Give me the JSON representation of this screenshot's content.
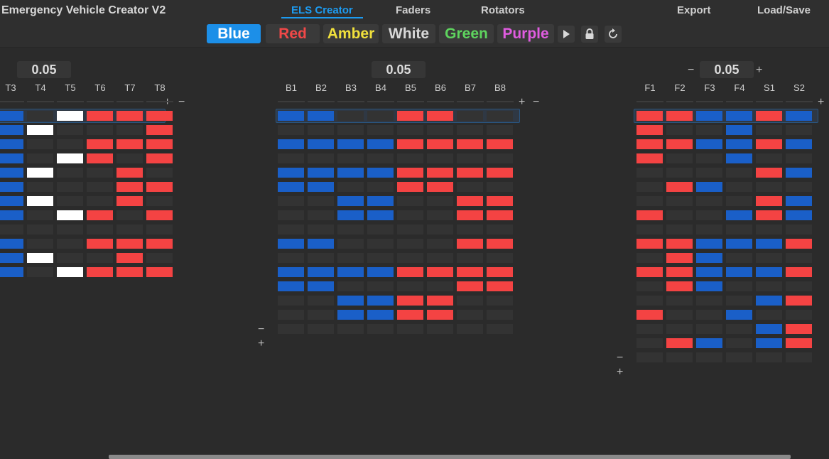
{
  "app": {
    "title": "Emergency Vehicle Creator V2"
  },
  "nav": {
    "tabs": [
      {
        "label": "ELS Creator",
        "active": true
      },
      {
        "label": "Faders"
      },
      {
        "label": "Rotators"
      }
    ],
    "right": [
      {
        "label": "Export"
      },
      {
        "label": "Load/Save"
      }
    ]
  },
  "colors": {
    "buttons": [
      {
        "label": "Blue",
        "color": "#ffffff",
        "bg": "#1c8fe8",
        "selected": true
      },
      {
        "label": "Red",
        "color": "#f14848"
      },
      {
        "label": "Amber",
        "color": "#f0e03c"
      },
      {
        "label": "White",
        "color": "#d8d8d8"
      },
      {
        "label": "Green",
        "color": "#5ed45e"
      },
      {
        "label": "Purple",
        "color": "#e05ce0"
      }
    ],
    "icons": [
      "play-icon",
      "lock-icon",
      "refresh-icon"
    ],
    "cell_palette": {
      "B": "#1a5fc8",
      "R": "#f44343",
      "W": "#ffffff",
      "E": "#333333"
    }
  },
  "panels": [
    {
      "name": "panel-t",
      "duration": "0.05",
      "headers": [
        "T3",
        "T4",
        "T5",
        "T6",
        "T7",
        "T8"
      ],
      "rows": [
        "B.WRRR",
        "BW...R",
        "B..RRR",
        "B.WR.R",
        "BW..R.",
        "B...RR",
        "BW..R.",
        "B.WR.R",
        "......",
        "B..RRR",
        "BW..R.",
        "B.WRRR"
      ]
    },
    {
      "name": "panel-b",
      "duration": "0.05",
      "headers": [
        "B1",
        "B2",
        "B3",
        "B4",
        "B5",
        "B6",
        "B7",
        "B8"
      ],
      "rows": [
        "BB..RR..",
        "........",
        "BBBBRRRR",
        "........",
        "BBBBRRRR",
        "BB..RR..",
        "..BB..RR",
        "..BB..RR",
        "........",
        "BB....RR",
        "........",
        "BBBBRRRR",
        "BB....RR",
        "..BBRR..",
        "..BBRR..",
        "........"
      ]
    },
    {
      "name": "panel-f",
      "duration": "0.05",
      "headers": [
        "F1",
        "F2",
        "F3",
        "F4",
        "S1",
        "S2"
      ],
      "rows": [
        "RRBBRB",
        "R..B..",
        "RRBBRB",
        "R..B..",
        "....RB",
        ".RB...",
        "....RB",
        "R..BRB",
        "......",
        "RRBBBR",
        ".RB...",
        "RRBBBR",
        ".RB...",
        "....BR",
        "R..B..",
        "....BR",
        ".RB.BR",
        "......"
      ]
    }
  ]
}
